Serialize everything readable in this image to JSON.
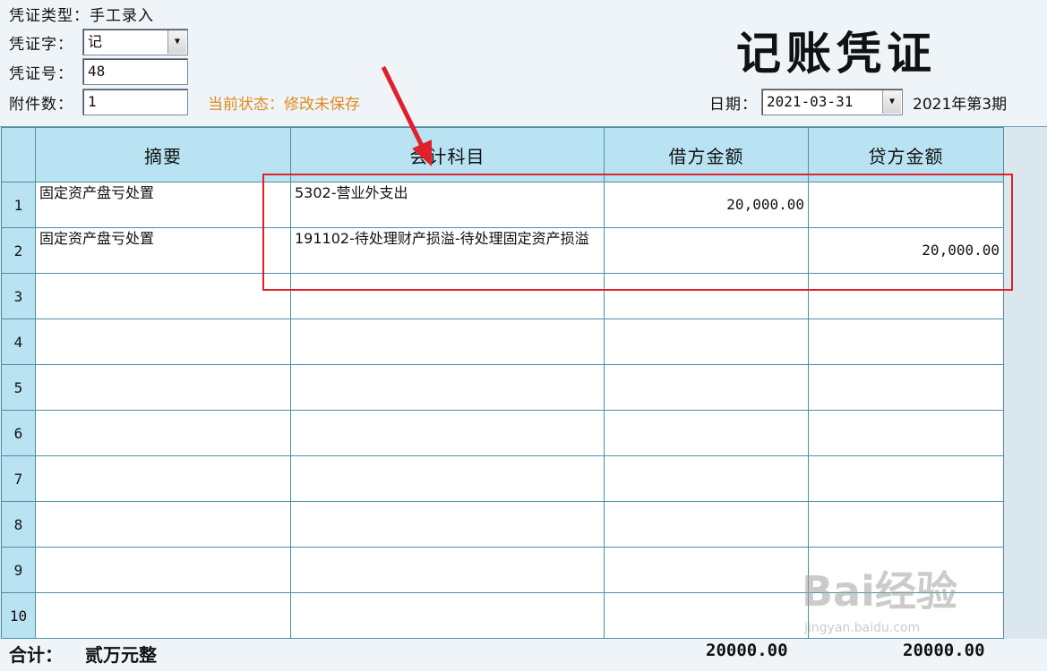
{
  "header": {
    "voucher_type_label": "凭证类型：",
    "voucher_type_value": "手工录入",
    "voucher_word_label": "凭证字：",
    "voucher_word_value": "记",
    "voucher_no_label": "凭证号：",
    "voucher_no_value": "48",
    "attachments_label": "附件数：",
    "attachments_value": "1",
    "status_text": "当前状态：修改未保存",
    "title": "记账凭证",
    "date_label": "日期：",
    "date_value": "2021-03-31",
    "period_text": "2021年第3期"
  },
  "table": {
    "headers": [
      "摘要",
      "会计科目",
      "借方金额",
      "贷方金额"
    ],
    "rows": [
      {
        "no": "1",
        "summary": "固定资产盘亏处置",
        "account": "5302-营业外支出",
        "debit": "20,000.00",
        "credit": ""
      },
      {
        "no": "2",
        "summary": "固定资产盘亏处置",
        "account": "191102-待处理财产损溢-待处理固定资产损溢",
        "debit": "",
        "credit": "20,000.00"
      },
      {
        "no": "3",
        "summary": "",
        "account": "",
        "debit": "",
        "credit": ""
      },
      {
        "no": "4",
        "summary": "",
        "account": "",
        "debit": "",
        "credit": ""
      },
      {
        "no": "5",
        "summary": "",
        "account": "",
        "debit": "",
        "credit": ""
      },
      {
        "no": "6",
        "summary": "",
        "account": "",
        "debit": "",
        "credit": ""
      },
      {
        "no": "7",
        "summary": "",
        "account": "",
        "debit": "",
        "credit": ""
      },
      {
        "no": "8",
        "summary": "",
        "account": "",
        "debit": "",
        "credit": ""
      },
      {
        "no": "9",
        "summary": "",
        "account": "",
        "debit": "",
        "credit": ""
      },
      {
        "no": "10",
        "summary": "",
        "account": "",
        "debit": "",
        "credit": ""
      }
    ]
  },
  "footer": {
    "total_label": "合计：",
    "total_words": "贰万元整",
    "debit_total": "20000.00",
    "credit_total": "20000.00"
  },
  "watermark": {
    "brand": "Bai经验",
    "url": "jingyan.baidu.com"
  },
  "colors": {
    "header_bg": "#b9e3f3",
    "grid_line": "#4f8ea3",
    "status": "#e08a1e",
    "annotation": "#e0202a"
  }
}
